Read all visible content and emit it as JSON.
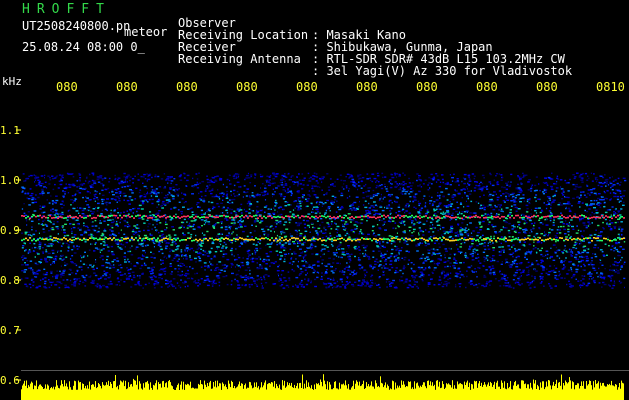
{
  "header": {
    "app_title": "HROFFT",
    "file_name": "UT2508240800.pn",
    "mode_label": "meteor",
    "datetime": "25.08.24 08:00",
    "extra": "0_",
    "meta": [
      {
        "key": "Observer",
        "value": ": Masaki Kano"
      },
      {
        "key": "Receiving Location",
        "value": ": Shibukawa, Gunma, Japan"
      },
      {
        "key": "Receiver",
        "value": ": RTL-SDR SDR# 43dB L15 103.2MHz CW"
      },
      {
        "key": "Receiving Antenna",
        "value": ": 3el Yagi(V) Az 330 for Vladivostok"
      }
    ]
  },
  "chart_data": {
    "type": "heatmap",
    "ylabel": "kHz",
    "x_tick_labels": [
      "080",
      "080",
      "080",
      "080",
      "080",
      "080",
      "080",
      "080",
      "080",
      "0810"
    ],
    "y_tick_labels": [
      "1.1",
      "1.0",
      "0.9",
      "0.8",
      "0.7",
      "0.6"
    ],
    "y_ticks": [
      1.1,
      1.0,
      0.9,
      0.8,
      0.7,
      0.6
    ],
    "ylim": [
      0.6,
      1.15
    ],
    "noise_band_khz": [
      0.785,
      1.015
    ],
    "signal_lines": [
      {
        "freq_khz": 0.928,
        "color": "#ff3060"
      },
      {
        "freq_khz": 0.883,
        "color": "#ffd020"
      }
    ],
    "colors": {
      "ticks": "#ffff33",
      "low": "#0000c8",
      "mid": "#00c8c8",
      "high": "#20ff60",
      "level_bar": "#ffff00"
    }
  }
}
